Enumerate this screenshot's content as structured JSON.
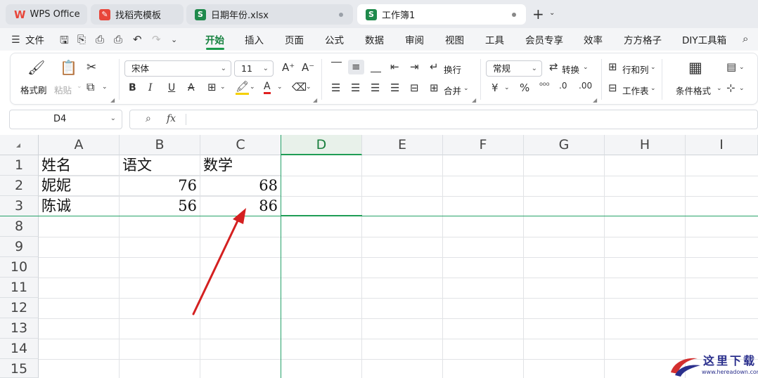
{
  "tabs": [
    {
      "label": "WPS Office",
      "icon": "wps-logo-icon"
    },
    {
      "label": "找稻壳模板",
      "icon": "docer-icon"
    },
    {
      "label": "日期年份.xlsx",
      "icon": "spreadsheet-icon"
    },
    {
      "label": "工作簿1",
      "icon": "spreadsheet-icon",
      "active": true
    }
  ],
  "menu": {
    "file": "文件",
    "items": [
      "开始",
      "插入",
      "页面",
      "公式",
      "数据",
      "审阅",
      "视图",
      "工具",
      "会员专享",
      "效率",
      "方方格子",
      "DIY工具箱"
    ],
    "active": "开始"
  },
  "ribbon": {
    "format_painter": "格式刷",
    "paste": "粘贴",
    "font_name": "宋体",
    "font_size": "11",
    "wrap": "换行",
    "merge": "合并",
    "number_format": "常规",
    "convert": "转换",
    "row_col": "行和列",
    "worksheet": "工作表",
    "cond_format": "条件格式"
  },
  "formula_bar": {
    "name_box": "D4",
    "fx": "fx",
    "content": ""
  },
  "sheet": {
    "columns": [
      "A",
      "B",
      "C",
      "D",
      "E",
      "F",
      "G",
      "H",
      "I"
    ],
    "selected_column": "D",
    "rows": [
      {
        "num": "1",
        "cells": [
          "姓名",
          "语文",
          "数学"
        ]
      },
      {
        "num": "2",
        "cells": [
          "妮妮",
          "76",
          "68"
        ]
      },
      {
        "num": "3",
        "cells": [
          "陈诚",
          "56",
          "86"
        ]
      },
      {
        "num": "8",
        "cells": []
      },
      {
        "num": "9",
        "cells": []
      },
      {
        "num": "10",
        "cells": []
      },
      {
        "num": "11",
        "cells": []
      },
      {
        "num": "12",
        "cells": []
      },
      {
        "num": "13",
        "cells": []
      },
      {
        "num": "14",
        "cells": []
      },
      {
        "num": "15",
        "cells": []
      }
    ]
  },
  "watermark": {
    "text": "这里下载",
    "url": "www.hereadown.com"
  },
  "colors": {
    "accent_green": "#1a9b4b",
    "freeze_line": "#26a269",
    "arrow_red": "#d42020",
    "wps_red": "#e8463a"
  }
}
